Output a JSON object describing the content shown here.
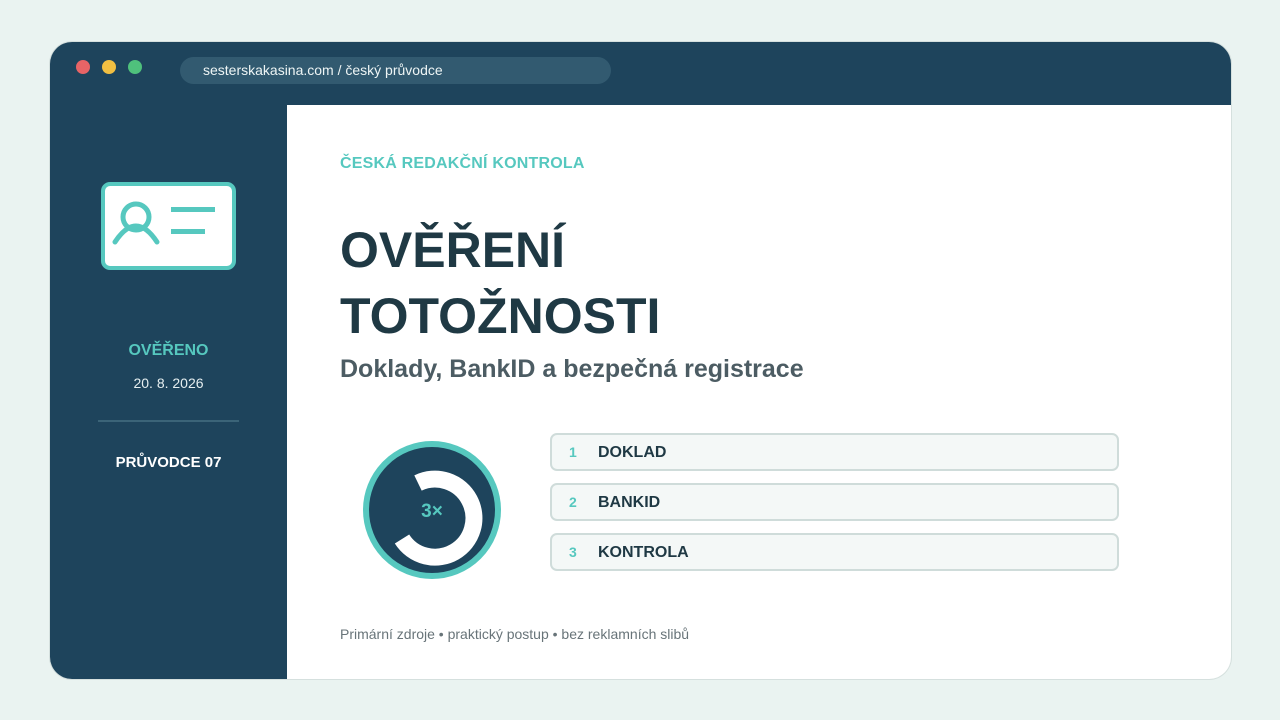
{
  "browser": {
    "url": "sesterskakasina.com / český průvodce"
  },
  "sidebar": {
    "icon": "id-card-icon",
    "status": "OVĚŘENO",
    "date": "20. 8. 2026",
    "guide": "PRŮVODCE 07"
  },
  "main": {
    "eyebrow": "ČESKÁ REDAKČNÍ KONTROLA",
    "title_line1": "OVĚŘENÍ",
    "title_line2": "TOTOŽNOSTI",
    "subtitle": "Doklady, BankID a bezpečná registrace",
    "badge": "3×",
    "steps": [
      {
        "num": "1",
        "label": "DOKLAD"
      },
      {
        "num": "2",
        "label": "BANKID"
      },
      {
        "num": "3",
        "label": "KONTROLA"
      }
    ],
    "footer": "Primární zdroje • praktický postup • bez reklamních slibů"
  },
  "colors": {
    "accent": "#56c8bf",
    "navy": "#1e445c",
    "text": "#1f3944",
    "background": "#eaf3f1"
  }
}
